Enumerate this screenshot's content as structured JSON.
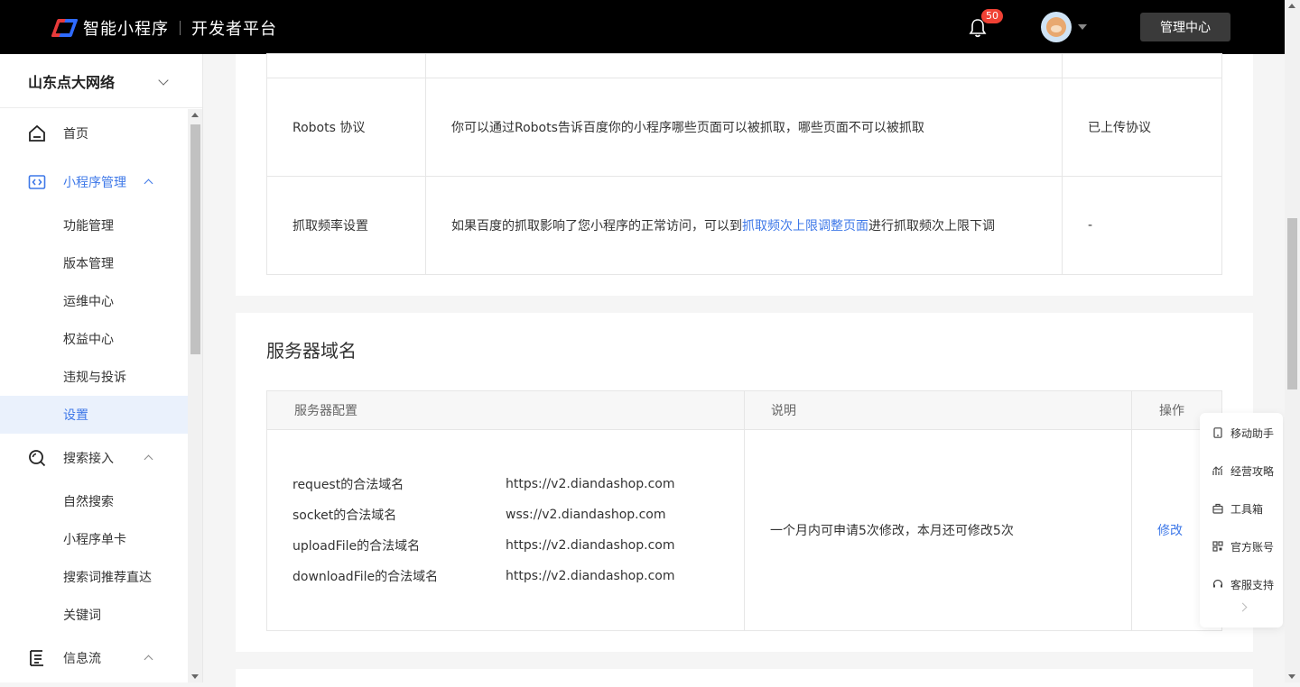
{
  "header": {
    "app_name": "智能小程序",
    "platform_name": "开发者平台",
    "notification_count": "50",
    "admin_button": "管理中心"
  },
  "sidebar": {
    "org_name": "山东点大网络",
    "items": [
      {
        "label": "首页",
        "icon": "home-icon"
      },
      {
        "label": "小程序管理",
        "icon": "code-icon",
        "expanded": true
      },
      {
        "label": "功能管理"
      },
      {
        "label": "版本管理"
      },
      {
        "label": "运维中心"
      },
      {
        "label": "权益中心"
      },
      {
        "label": "违规与投诉"
      },
      {
        "label": "设置",
        "active": true
      },
      {
        "label": "搜索接入",
        "icon": "search-icon",
        "expanded": true
      },
      {
        "label": "自然搜索"
      },
      {
        "label": "小程序单卡"
      },
      {
        "label": "搜索词推荐直达"
      },
      {
        "label": "关键词"
      },
      {
        "label": "信息流",
        "icon": "list-icon",
        "expanded": true
      }
    ]
  },
  "crawl_table": {
    "rows": [
      {
        "name": "Robots 协议",
        "desc": "你可以通过Robots告诉百度你的小程序哪些页面可以被抓取，哪些页面不可以被抓取",
        "status": "已上传协议"
      },
      {
        "name": "抓取频率设置",
        "desc_prefix": "如果百度的抓取影响了您小程序的正常访问，可以到",
        "desc_link": "抓取频次上限调整页面",
        "desc_suffix": "进行抓取频次上限下调",
        "status": "-"
      }
    ]
  },
  "server_domain": {
    "title": "服务器域名",
    "headers": {
      "config": "服务器配置",
      "desc": "说明",
      "action": "操作"
    },
    "domains": [
      {
        "key": "request的合法域名",
        "value": "https://v2.diandashop.com"
      },
      {
        "key": "socket的合法域名",
        "value": "wss://v2.diandashop.com"
      },
      {
        "key": "uploadFile的合法域名",
        "value": "https://v2.diandashop.com"
      },
      {
        "key": "downloadFile的合法域名",
        "value": "https://v2.diandashop.com"
      }
    ],
    "note": "一个月内可申请5次修改，本月还可修改5次",
    "modify": "修改"
  },
  "float_panel": {
    "items": [
      {
        "label": "移动助手",
        "icon": "mobile-icon"
      },
      {
        "label": "经营攻略",
        "icon": "chart-icon"
      },
      {
        "label": "工具箱",
        "icon": "toolbox-icon"
      },
      {
        "label": "官方账号",
        "icon": "qrcode-icon"
      },
      {
        "label": "客服支持",
        "icon": "headset-icon"
      }
    ]
  },
  "colors": {
    "accent": "#3e78e8",
    "header_bg": "#000000",
    "badge": "#f04134"
  }
}
